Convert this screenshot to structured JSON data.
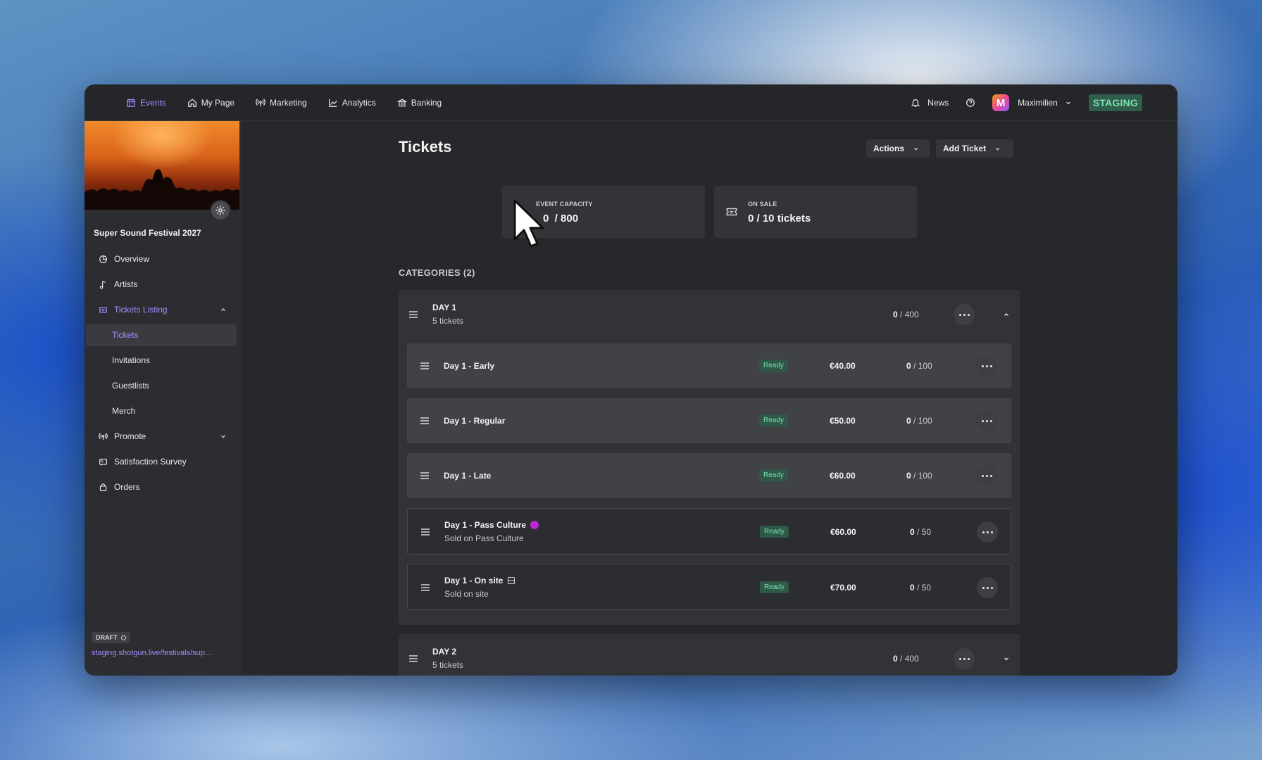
{
  "topnav": {
    "items": [
      {
        "label": "Events",
        "icon": "calendar-icon",
        "active": true
      },
      {
        "label": "My Page",
        "icon": "home-icon"
      },
      {
        "label": "Marketing",
        "icon": "broadcast-icon"
      },
      {
        "label": "Analytics",
        "icon": "chart-icon"
      },
      {
        "label": "Banking",
        "icon": "bank-icon"
      }
    ],
    "news_label": "News",
    "user_initial": "M",
    "user_name": "Maximilien",
    "env_badge": "STAGING"
  },
  "sidebar": {
    "event_name": "Super Sound Festival 2027",
    "items": [
      {
        "label": "Overview",
        "icon": "pie-chart-icon"
      },
      {
        "label": "Artists",
        "icon": "music-note-icon"
      },
      {
        "label": "Tickets Listing",
        "icon": "ticket-icon",
        "active": true
      },
      {
        "label": "Promote",
        "icon": "broadcast-icon"
      },
      {
        "label": "Satisfaction Survey",
        "icon": "survey-icon"
      },
      {
        "label": "Orders",
        "icon": "bag-icon"
      }
    ],
    "sub_items": [
      {
        "label": "Tickets",
        "active": true
      },
      {
        "label": "Invitations"
      },
      {
        "label": "Guestlists"
      },
      {
        "label": "Merch"
      }
    ],
    "status_badge": "DRAFT",
    "site_link": "staging.shotgun.live/festivals/sup..."
  },
  "main": {
    "title": "Tickets",
    "actions_label": "Actions",
    "add_ticket_label": "Add Ticket",
    "stats": {
      "capacity_label": "EVENT CAPACITY",
      "capacity_value": "0  / 800",
      "on_sale_label": "ON SALE",
      "on_sale_value": "0 / 10 tickets"
    },
    "categories_title": "CATEGORIES (2)",
    "categories": [
      {
        "name": "DAY 1",
        "count": "5 tickets",
        "sold": "0",
        "capacity": " / 400",
        "tickets": [
          {
            "name": "Day 1 - Early",
            "status": "Ready",
            "price": "€40.00",
            "sold": "0",
            "capacity": " / 100"
          },
          {
            "name": "Day 1 - Regular",
            "status": "Ready",
            "price": "€50.00",
            "sold": "0",
            "capacity": " / 100"
          },
          {
            "name": "Day 1 - Late",
            "status": "Ready",
            "price": "€60.00",
            "sold": "0",
            "capacity": " / 100"
          },
          {
            "name": "Day 1 - Pass Culture",
            "subtitle": "Sold on Pass Culture",
            "status": "Ready",
            "price": "€60.00",
            "sold": "0",
            "capacity": " / 50"
          },
          {
            "name": "Day 1 - On site",
            "subtitle": "Sold on site",
            "status": "Ready",
            "price": "€70.00",
            "sold": "0",
            "capacity": " / 50"
          }
        ]
      },
      {
        "name": "DAY 2",
        "count": "5 tickets",
        "sold": "0",
        "capacity": " / 400"
      }
    ]
  },
  "colors": {
    "accent": "#a78bfa",
    "ready_badge_bg": "#2e5847",
    "ready_badge_text": "#7ee0b0",
    "window_bg": "#27282b"
  }
}
